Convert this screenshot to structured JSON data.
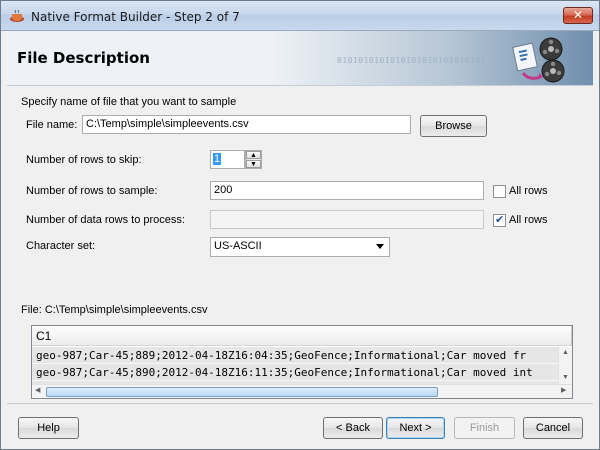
{
  "window": {
    "title": "Native Format Builder - Step 2 of 7",
    "close_glyph": "✕"
  },
  "banner": {
    "title": "File Description",
    "bits": "0101010101010101010101010101 0101010101"
  },
  "form": {
    "intro": "Specify name of file that you want to sample",
    "file_name_label": "File name:",
    "file_name_value": "C:\\Temp\\simple\\simpleevents.csv",
    "browse_label": "Browse",
    "skip_label": "Number of rows to skip:",
    "skip_value": "1",
    "sample_label": "Number of rows to sample:",
    "sample_value": "200",
    "all_rows_sample_label": "All rows",
    "all_rows_sample_checked": false,
    "process_label": "Number of data rows to process:",
    "process_value": "",
    "all_rows_process_label": "All rows",
    "all_rows_process_checked": true,
    "charset_label": "Character set:",
    "charset_value": "US-ASCII"
  },
  "preview": {
    "file_label": "File: C:\\Temp\\simple\\simpleevents.csv",
    "column_header": "C1",
    "rows": [
      "geo-987;Car-45;889;2012-04-18Z16:04:35;GeoFence;Informational;Car moved  fr",
      "geo-987;Car-45;890;2012-04-18Z16:11:35;GeoFence;Informational;Car moved int"
    ]
  },
  "footer": {
    "help_label": "Help",
    "back_label": "< Back",
    "next_label": "Next >",
    "finish_label": "Finish",
    "cancel_label": "Cancel"
  },
  "colors": {
    "accent": "#3c7fb1",
    "checkbox_mark": "#1c4f9a",
    "close_button": "#c43d23"
  },
  "icons": {
    "title": "coffee-cup-icon",
    "banner": "film-reel-document-icon",
    "close": "close-icon",
    "spinner_up": "triangle-up-icon",
    "spinner_down": "triangle-down-icon",
    "dropdown": "chevron-down-icon"
  }
}
